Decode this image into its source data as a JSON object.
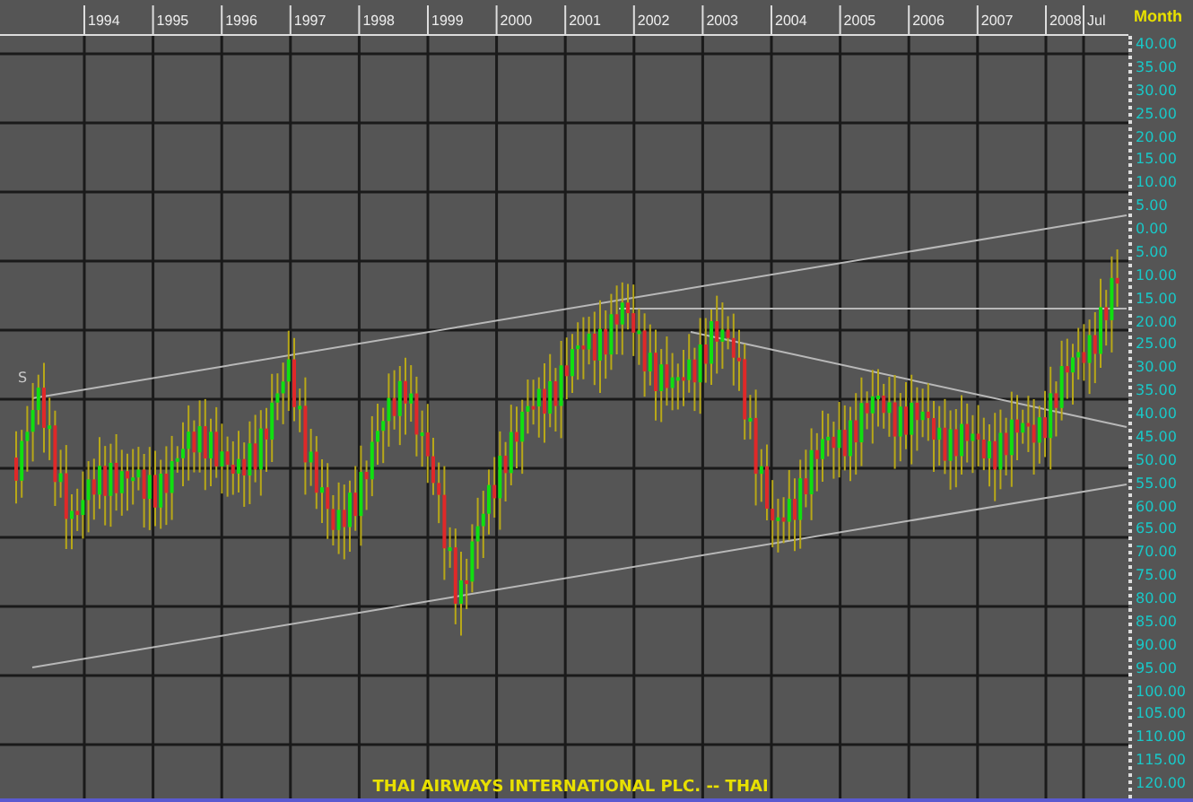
{
  "chart": {
    "title": "THAI AIRWAYS INTERNATIONAL PLC. -- THAI",
    "period_label": "Month",
    "years": [
      "1994",
      "1995",
      "1996",
      "1997",
      "1998",
      "1999",
      "2000",
      "2001",
      "2002",
      "2003",
      "2004",
      "2005",
      "2006",
      "2007",
      "2008",
      "Jul"
    ],
    "price_axis": [
      "40.00",
      "35.00",
      "30.00",
      "25.00",
      "20.00",
      "15.00",
      "10.00",
      "5.00",
      "0.00",
      "5.00",
      "10.00",
      "15.00",
      "20.00",
      "25.00",
      "30.00",
      "35.00",
      "40.00",
      "45.00",
      "50.00",
      "55.00",
      "60.00",
      "65.00",
      "70.00",
      "75.00",
      "80.00",
      "85.00",
      "90.00",
      "95.00",
      "100.00",
      "105.00",
      "110.00",
      "115.00",
      "120.00"
    ],
    "marker_label": "S"
  }
}
